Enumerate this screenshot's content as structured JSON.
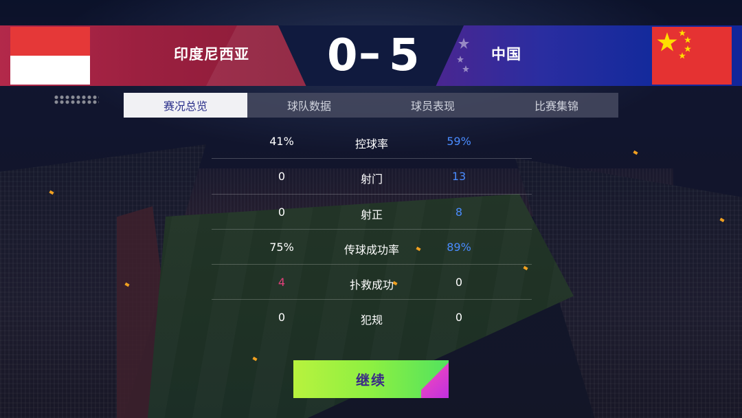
{
  "home_team": {
    "name": "印度尼西亚",
    "score": "0",
    "color": "#b3294a",
    "flag_icon": "indonesia-flag-icon"
  },
  "away_team": {
    "name": "中国",
    "score": "5",
    "color": "#12269a",
    "flag_icon": "china-flag-icon"
  },
  "score_separator": "–",
  "tabs": [
    {
      "label": "赛况总览",
      "active": true
    },
    {
      "label": "球队数据",
      "active": false
    },
    {
      "label": "球员表现",
      "active": false
    },
    {
      "label": "比赛集锦",
      "active": false
    }
  ],
  "stats": [
    {
      "label": "控球率",
      "home": "41%",
      "away": "59%",
      "home_color": "#ffffff",
      "away_color": "#4a8cff"
    },
    {
      "label": "射门",
      "home": "0",
      "away": "13",
      "home_color": "#ffffff",
      "away_color": "#4a8cff"
    },
    {
      "label": "射正",
      "home": "0",
      "away": "8",
      "home_color": "#ffffff",
      "away_color": "#4a8cff"
    },
    {
      "label": "传球成功率",
      "home": "75%",
      "away": "89%",
      "home_color": "#ffffff",
      "away_color": "#4a8cff"
    },
    {
      "label": "扑救成功",
      "home": "4",
      "away": "0",
      "home_color": "#e0407a",
      "away_color": "#ffffff"
    },
    {
      "label": "犯规",
      "home": "0",
      "away": "0",
      "home_color": "#ffffff",
      "away_color": "#ffffff"
    }
  ],
  "continue_label": "继续",
  "colors": {
    "active_tab_text": "#2a2f8a",
    "button_gradient_start": "#b8f23e",
    "button_gradient_end": "#52e25e"
  }
}
